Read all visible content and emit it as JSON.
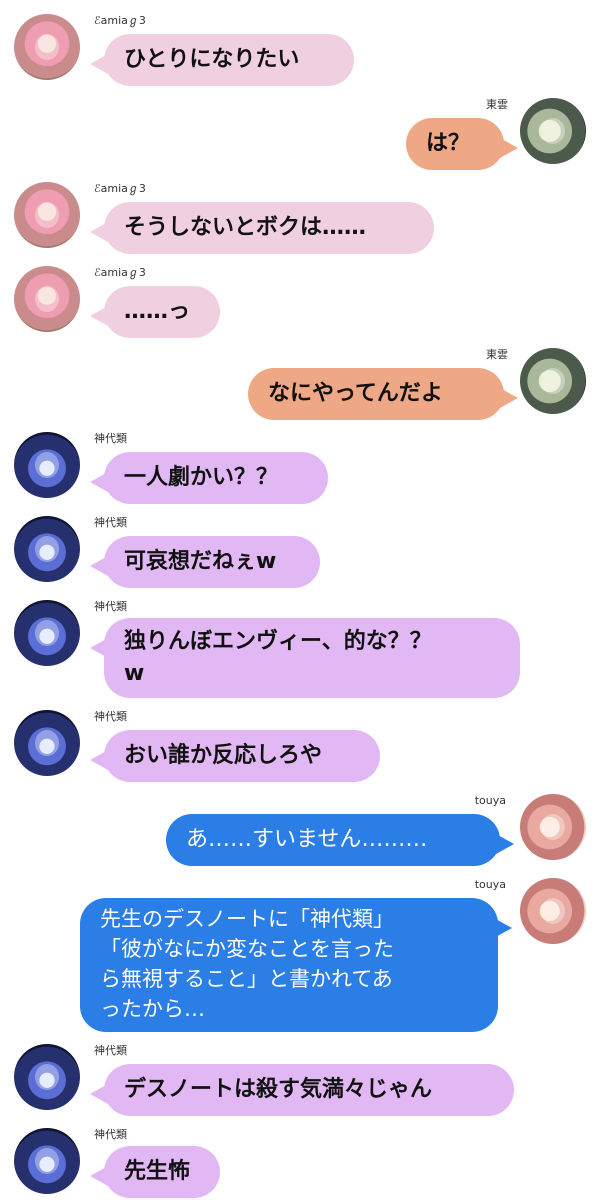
{
  "messages": [
    {
      "sender": "ℰamiaℊ3",
      "text": "ひとりになりたい"
    },
    {
      "sender": "東雲",
      "text": "は？"
    },
    {
      "sender": "ℰamiaℊ3",
      "text": "そうしないとボクは……"
    },
    {
      "sender": "ℰamiaℊ3",
      "text": "……っ"
    },
    {
      "sender": "東雲",
      "text": "なにやってんだよ"
    },
    {
      "sender": "神代類",
      "text": "一人劇かい？？"
    },
    {
      "sender": "神代類",
      "text": "可哀想だねぇw"
    },
    {
      "sender": "神代類",
      "text": "独りんぼエンヴィー、的な？？",
      "text2": "w"
    },
    {
      "sender": "神代類",
      "text": "おい誰か反応しろや"
    },
    {
      "sender": "touya",
      "text": "あ……すいません………"
    },
    {
      "sender": "touya",
      "text": "先生のデスノートに「神代類」",
      "text2": "「彼がなにか変なことを言った",
      "text3": "ら無視すること」と書かれてあ",
      "text4": "ったから…"
    },
    {
      "sender": "神代類",
      "text": "デスノートは殺す気満々じゃん"
    },
    {
      "sender": "神代類",
      "text": "先生怖"
    }
  ]
}
